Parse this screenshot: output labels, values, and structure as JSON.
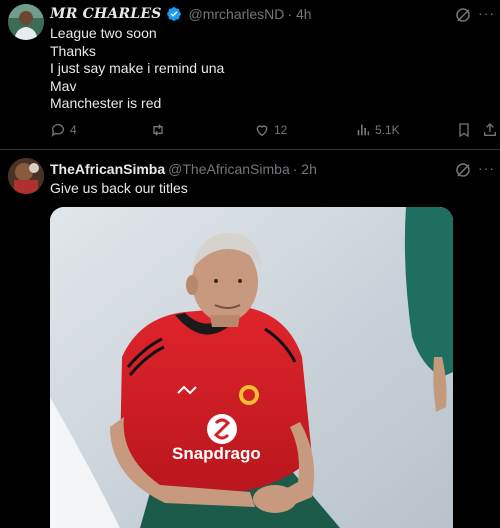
{
  "tweets": [
    {
      "display_name": "MR CHARLES",
      "handle": "@mrcharlesND",
      "time": "· 4h",
      "verified": true,
      "lines": [
        "League two soon",
        "Thanks",
        "I just say make i remind una",
        "Mav",
        "Manchester is red"
      ],
      "actions": {
        "reply_count": "4",
        "retweet_count": "",
        "like_count": "12",
        "views_count": "5.1K"
      }
    },
    {
      "display_name": "TheAfricanSimba",
      "handle": "@TheAfricanSimba",
      "time": "· 2h",
      "verified": false,
      "lines": [
        "Give us back our titles"
      ],
      "media": {
        "shirt_sponsor_text": "Snapdrago"
      }
    }
  ],
  "icons": {
    "verified": "verified-badge-icon",
    "grok": "grok-icon",
    "more": "more-options-icon",
    "reply": "reply-icon",
    "retweet": "retweet-icon",
    "like": "like-icon",
    "views": "views-icon",
    "bookmark": "bookmark-icon",
    "share": "share-icon"
  },
  "colors": {
    "background": "#000000",
    "text": "#e7e9ea",
    "muted": "#71767b",
    "verified": "#1d9bf0",
    "divider": "#2f3336",
    "jersey_red": "#d81f26"
  }
}
